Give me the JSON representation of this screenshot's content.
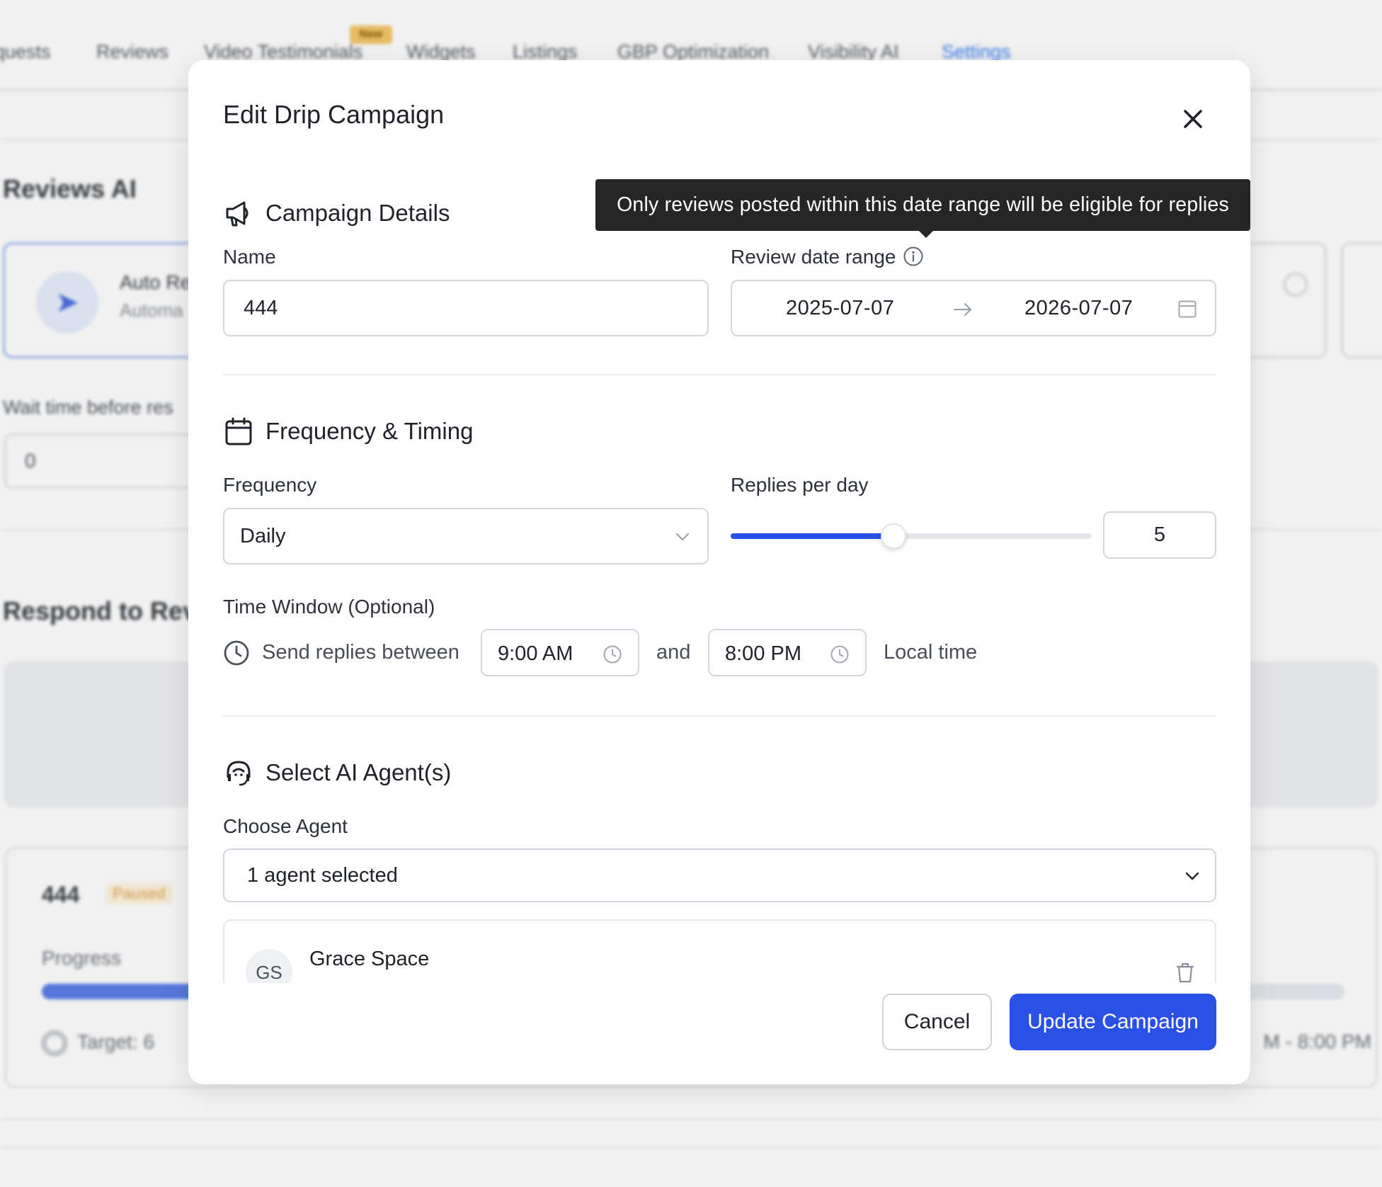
{
  "background": {
    "nav_items": [
      "quests",
      "Reviews",
      "Video Testimonials",
      "Widgets",
      "Listings",
      "GBP Optimization",
      "Visibility AI",
      "Settings"
    ],
    "new_badge": "New",
    "reviews_ai_title": "Reviews AI",
    "card_title": "Auto Re",
    "card_subtitle": "Automa",
    "wait_time_label": "Wait time before res",
    "wait_time_value": "0",
    "respond_title": "Respond to Revi",
    "campaign_name": "444",
    "campaign_status": "Paused",
    "progress_label": "Progress",
    "target_text": "Target:  6",
    "time_window_text": "M - 8:00 PM"
  },
  "modal": {
    "title": "Edit Drip Campaign",
    "tooltip": "Only reviews posted within this date range will be eligible for replies",
    "campaign_details": {
      "title": "Campaign Details",
      "name_label": "Name",
      "name_value": "444",
      "date_range_label": "Review date range",
      "date_start": "2025-07-07",
      "date_end": "2026-07-07"
    },
    "frequency_timing": {
      "title": "Frequency & Timing",
      "frequency_label": "Frequency",
      "frequency_value": "Daily",
      "replies_label": "Replies per day",
      "replies_value": "5",
      "replies_slider_fraction": 0.45,
      "time_window_label": "Time Window (Optional)",
      "send_between": "Send replies between",
      "start_time": "9:00 AM",
      "and_text": "and",
      "end_time": "8:00 PM",
      "local_time": "Local time"
    },
    "agents": {
      "title": "Select AI Agent(s)",
      "choose_label": "Choose Agent",
      "selected_text": "1 agent selected",
      "agent_name": "Grace Space",
      "agent_initials": "GS"
    },
    "cancel_label": "Cancel",
    "update_label": "Update Campaign"
  },
  "colors": {
    "primary": "#2b50e6",
    "tooltip_bg": "#262626"
  }
}
